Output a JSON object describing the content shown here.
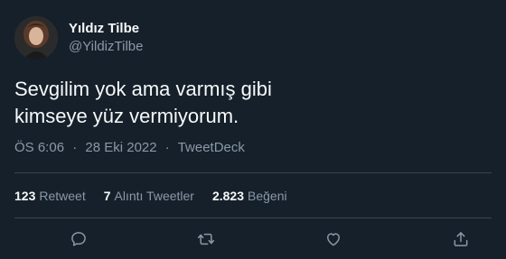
{
  "user": {
    "display_name": "Yıldız Tilbe",
    "handle": "@YildizTilbe",
    "avatar_icon": "profile-photo"
  },
  "tweet": {
    "text": "Sevgilim yok ama varmış gibi\nkimseye yüz vermiyorum.",
    "time": "ÖS 6:06",
    "date": "28 Eki 2022",
    "source": "TweetDeck",
    "separator": "·"
  },
  "stats": {
    "retweets": {
      "count": "123",
      "label": "Retweet"
    },
    "quotes": {
      "count": "7",
      "label": "Alıntı Tweetler"
    },
    "likes": {
      "count": "2.823",
      "label": "Beğeni"
    }
  },
  "actions": [
    {
      "icon": "reply-icon"
    },
    {
      "icon": "retweet-icon"
    },
    {
      "icon": "like-icon"
    },
    {
      "icon": "share-icon"
    }
  ],
  "colors": {
    "background": "#15202b",
    "text": "#f7f9f9",
    "secondary": "#8b98a5",
    "divider": "#38444d"
  }
}
